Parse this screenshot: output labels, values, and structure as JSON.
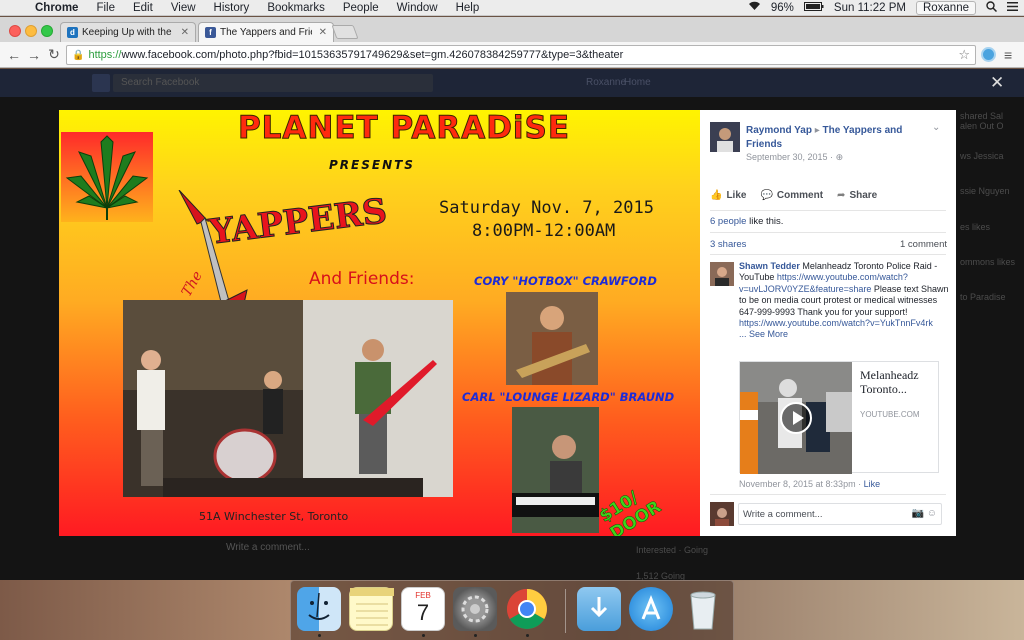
{
  "menubar": {
    "app_name": "Chrome",
    "menus": [
      "File",
      "Edit",
      "View",
      "History",
      "Bookmarks",
      "People",
      "Window",
      "Help"
    ],
    "battery": "96%",
    "clock": "Sun 11:22 PM",
    "user": "Roxanne"
  },
  "browser": {
    "tabs": [
      {
        "title": "Keeping Up with the Kardas",
        "favicon": "d",
        "favicon_color": "#1e73be"
      },
      {
        "title": "The Yappers and Friends",
        "favicon": "f",
        "favicon_color": "#3b5998"
      }
    ],
    "url_scheme": "https://",
    "url_rest": "www.facebook.com/photo.php?fbid=10153635791749629&set=gm.426078384259777&type=3&theater"
  },
  "fb_background": {
    "search_placeholder": "Search Facebook",
    "nav_user": "Roxanne",
    "nav_home": "Home",
    "write_comment": "Write a comment...",
    "right_snippets": [
      "shared Sal",
      "alen Out O",
      "ws Jessica",
      "ssie Nguyen",
      "es likes",
      "ommons likes",
      "to Paradise"
    ],
    "bottom_snippets": [
      "Interested · Going",
      "1,512 Going"
    ]
  },
  "photo": {
    "title": "PLANET PARADiSE",
    "presents": "PRESENTS",
    "date": "Saturday Nov. 7, 2015",
    "time": "8:00PM-12:00AM",
    "band": "YAPPERS",
    "the": "The",
    "and_friends": "And Friends:",
    "guest1": "CORY \"HOTBOX\" CRAWFORD",
    "guest2": "CARL \"LOUNGE LIZARD\" BRAUND",
    "address": "51A Winchester St, Toronto",
    "door": "$10/ DOOR"
  },
  "post": {
    "author": "Raymond Yap",
    "group": "The Yappers and Friends",
    "date": "September 30, 2015 ·",
    "actions": {
      "like": "Like",
      "comment": "Comment",
      "share": "Share"
    },
    "likes_link": "6 people",
    "likes_rest": " like this.",
    "shares": "3 shares",
    "comment_count": "1 comment",
    "comment": {
      "author": "Shawn Tedder",
      "text1": " Melanheadz Toronto Police Raid - YouTube ",
      "link1": "https://www.youtube.com/watch?v=uvLJORV0YZE&feature=share",
      "text2": " Please text Shawn to be on media court protest or medical witnesses 647-999-9993 Thank you for your support! ",
      "link2": "https://www.youtube.com/watch?v=YukTnnFv4rk",
      "see_more": "... See More",
      "preview_title": "Melanheadz Toronto...",
      "preview_domain": "YOUTUBE.COM",
      "timestamp": "November 8, 2015 at 8:33pm · ",
      "like": "Like"
    },
    "write_placeholder": "Write a comment..."
  },
  "dock": {
    "items": [
      "finder-icon",
      "notes-icon",
      "calendar-icon",
      "system-preferences-icon",
      "chrome-icon",
      "downloads-icon",
      "app-store-icon",
      "trash-icon"
    ],
    "calendar_month": "FEB",
    "calendar_day": "7"
  }
}
